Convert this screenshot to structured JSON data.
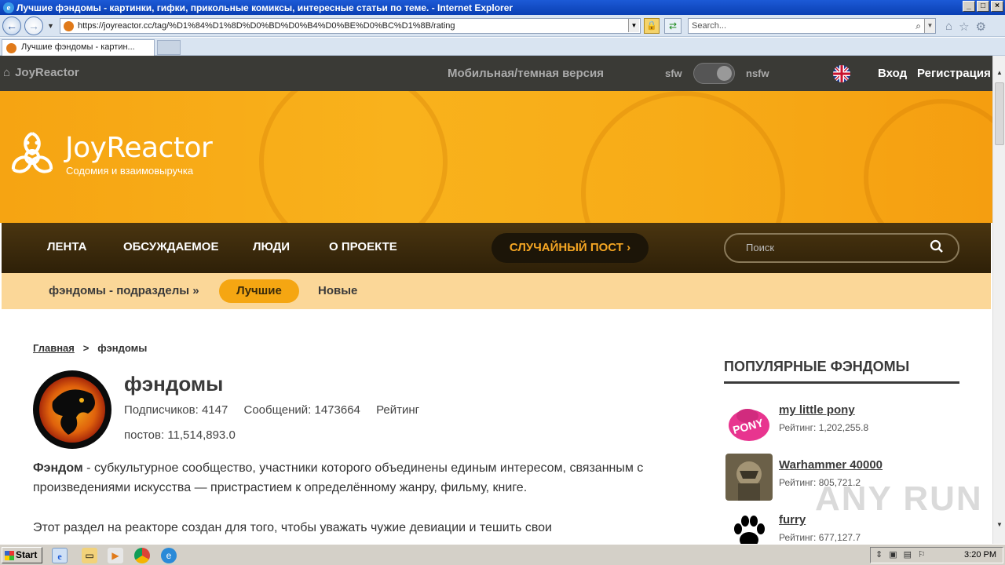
{
  "browser": {
    "window_title": "Лучшие фэндомы - картинки, гифки, прикольные комиксы, интересные статьи по теме. - Internet Explorer",
    "url": "https://joyreactor.cc/tag/%D1%84%D1%8D%D0%BD%D0%B4%D0%BE%D0%BC%D1%8B/rating",
    "search_placeholder": "Search...",
    "tab_title": "Лучшие фэндомы - картин..."
  },
  "site_bar": {
    "home_label": "JoyReactor",
    "mobile_label": "Мобильная/темная версия",
    "sfw_label": "sfw",
    "nsfw_label": "nsfw",
    "login_label": "Вход",
    "register_label": "Регистрация"
  },
  "banner": {
    "logo_title": "JoyReactor",
    "logo_subtitle": "Содомия и взаимовыручка"
  },
  "main_nav": {
    "items": [
      "ЛЕНТА",
      "ОБСУЖДАЕМОЕ",
      "ЛЮДИ",
      "О ПРОЕКТЕ"
    ],
    "random_post": "СЛУЧАЙНЫЙ ПОСТ",
    "search_placeholder": "Поиск"
  },
  "sub_nav": {
    "sections": "фэндомы - подразделы »",
    "best": "Лучшие",
    "new": "Новые"
  },
  "breadcrumb": {
    "home": "Главная",
    "separator": ">",
    "current": "фэндомы"
  },
  "fandom": {
    "title": "фэндомы",
    "subscribers": "Подписчиков: 4147",
    "messages": "Сообщений: 1473664",
    "rating": "Рейтинг",
    "posts": "постов: 11,514,893.0",
    "desc_term": "Фэндом",
    "desc_rest": " - субкультурное сообщество, участники которого объединены единым интересом, связанным с произведениями искусства — пристрастием к определённому жанру, фильму, книге.",
    "desc2": "Этот раздел на реакторе создан для того, чтобы уважать чужие девиации и тешить свои"
  },
  "sidebar": {
    "heading": "ПОПУЛЯРНЫЕ ФЭНДОМЫ",
    "items": [
      {
        "name": "my little pony",
        "rating": "Рейтинг: 1,202,255.8",
        "icon": "mlp-logo-icon"
      },
      {
        "name": "Warhammer 40000",
        "rating": "Рейтинг: 805,721.2",
        "icon": "warhammer-thumbnail"
      },
      {
        "name": "furry",
        "rating": "Рейтинг: 677,127.7",
        "icon": "paw-icon"
      }
    ]
  },
  "watermark": "ANY RUN",
  "taskbar": {
    "start_label": "Start",
    "clock": "3:20 PM"
  },
  "colors": {
    "accent": "#f5a612",
    "dark_bar": "#3a3a36",
    "nav_brown": "#3b2a0e",
    "subnav_bg": "#fbd798"
  }
}
